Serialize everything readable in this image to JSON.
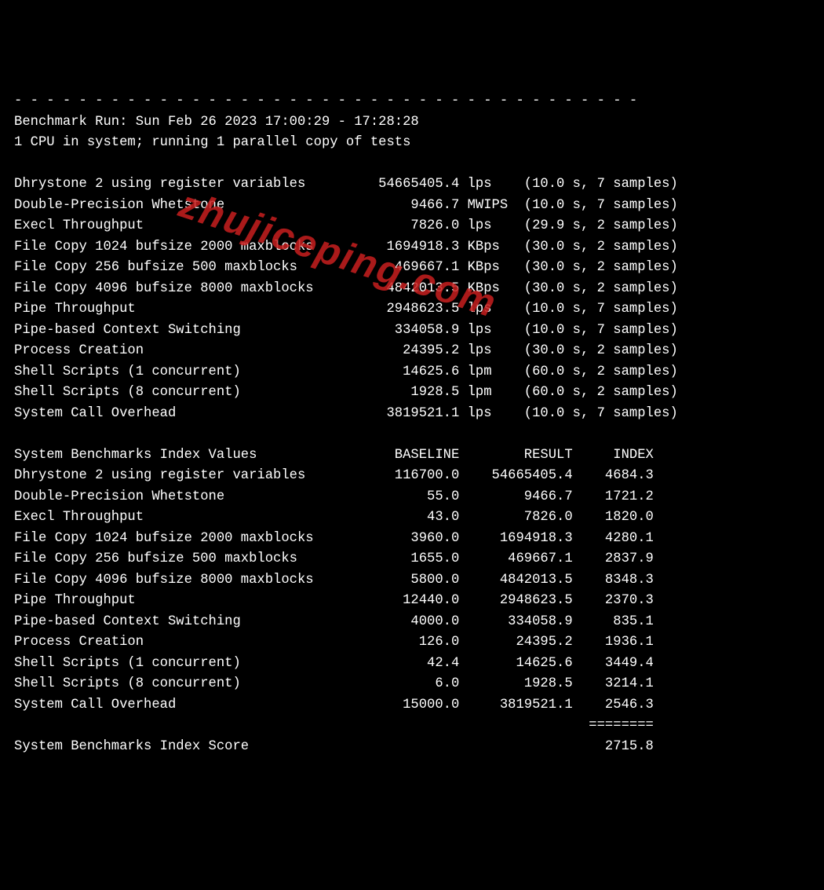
{
  "dashes": "- - - - - - - - - - - - - - - - - - - - - - - - - - - - - - - - - - - - - - -",
  "header": {
    "run_line": "Benchmark Run: Sun Feb 26 2023 17:00:29 - 17:28:28",
    "cpu_line": "1 CPU in system; running 1 parallel copy of tests"
  },
  "watermark": "zhujiceping.com",
  "tests": [
    {
      "name": "Dhrystone 2 using register variables",
      "value": "54665405.4",
      "unit": "lps",
      "time": "10.0",
      "samples": "7"
    },
    {
      "name": "Double-Precision Whetstone",
      "value": "9466.7",
      "unit": "MWIPS",
      "time": "10.0",
      "samples": "7"
    },
    {
      "name": "Execl Throughput",
      "value": "7826.0",
      "unit": "lps",
      "time": "29.9",
      "samples": "2"
    },
    {
      "name": "File Copy 1024 bufsize 2000 maxblocks",
      "value": "1694918.3",
      "unit": "KBps",
      "time": "30.0",
      "samples": "2"
    },
    {
      "name": "File Copy 256 bufsize 500 maxblocks",
      "value": "469667.1",
      "unit": "KBps",
      "time": "30.0",
      "samples": "2"
    },
    {
      "name": "File Copy 4096 bufsize 8000 maxblocks",
      "value": "4842013.5",
      "unit": "KBps",
      "time": "30.0",
      "samples": "2"
    },
    {
      "name": "Pipe Throughput",
      "value": "2948623.5",
      "unit": "lps",
      "time": "10.0",
      "samples": "7"
    },
    {
      "name": "Pipe-based Context Switching",
      "value": "334058.9",
      "unit": "lps",
      "time": "10.0",
      "samples": "7"
    },
    {
      "name": "Process Creation",
      "value": "24395.2",
      "unit": "lps",
      "time": "30.0",
      "samples": "2"
    },
    {
      "name": "Shell Scripts (1 concurrent)",
      "value": "14625.6",
      "unit": "lpm",
      "time": "60.0",
      "samples": "2"
    },
    {
      "name": "Shell Scripts (8 concurrent)",
      "value": "1928.5",
      "unit": "lpm",
      "time": "60.0",
      "samples": "2"
    },
    {
      "name": "System Call Overhead",
      "value": "3819521.1",
      "unit": "lps",
      "time": "10.0",
      "samples": "7"
    }
  ],
  "index_header": {
    "name": "System Benchmarks Index Values",
    "c1": "BASELINE",
    "c2": "RESULT",
    "c3": "INDEX"
  },
  "index": [
    {
      "name": "Dhrystone 2 using register variables",
      "baseline": "116700.0",
      "result": "54665405.4",
      "index": "4684.3"
    },
    {
      "name": "Double-Precision Whetstone",
      "baseline": "55.0",
      "result": "9466.7",
      "index": "1721.2"
    },
    {
      "name": "Execl Throughput",
      "baseline": "43.0",
      "result": "7826.0",
      "index": "1820.0"
    },
    {
      "name": "File Copy 1024 bufsize 2000 maxblocks",
      "baseline": "3960.0",
      "result": "1694918.3",
      "index": "4280.1"
    },
    {
      "name": "File Copy 256 bufsize 500 maxblocks",
      "baseline": "1655.0",
      "result": "469667.1",
      "index": "2837.9"
    },
    {
      "name": "File Copy 4096 bufsize 8000 maxblocks",
      "baseline": "5800.0",
      "result": "4842013.5",
      "index": "8348.3"
    },
    {
      "name": "Pipe Throughput",
      "baseline": "12440.0",
      "result": "2948623.5",
      "index": "2370.3"
    },
    {
      "name": "Pipe-based Context Switching",
      "baseline": "4000.0",
      "result": "334058.9",
      "index": "835.1"
    },
    {
      "name": "Process Creation",
      "baseline": "126.0",
      "result": "24395.2",
      "index": "1936.1"
    },
    {
      "name": "Shell Scripts (1 concurrent)",
      "baseline": "42.4",
      "result": "14625.6",
      "index": "3449.4"
    },
    {
      "name": "Shell Scripts (8 concurrent)",
      "baseline": "6.0",
      "result": "1928.5",
      "index": "3214.1"
    },
    {
      "name": "System Call Overhead",
      "baseline": "15000.0",
      "result": "3819521.1",
      "index": "2546.3"
    }
  ],
  "score_rule": "========",
  "score": {
    "label": "System Benchmarks Index Score",
    "value": "2715.8"
  }
}
